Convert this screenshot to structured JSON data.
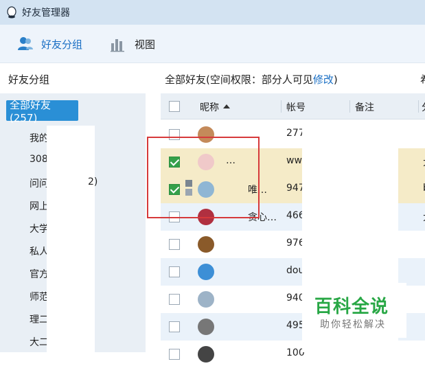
{
  "window": {
    "title": "好友管理器"
  },
  "toolbar": {
    "groups_label": "好友分组",
    "view_label": "视图"
  },
  "left": {
    "header": "好友分组",
    "all_group": "全部好友(257)",
    "groups": [
      "我的",
      "308",
      "问问",
      "网上",
      "大学",
      "私人",
      "官方",
      "师范",
      "理二",
      "大二"
    ],
    "partial_count": "2)"
  },
  "right": {
    "header_prefix": "全部好友(空间权限：部分人可见",
    "header_link": "修改",
    "header_suffix": ")",
    "edge_char": "希"
  },
  "table": {
    "columns": {
      "nickname": "昵称",
      "account": "帐号",
      "remark": "备注",
      "edge": "分"
    },
    "rows": [
      {
        "checked": false,
        "nickname": "",
        "account": "277",
        "bg": "#ffffff",
        "avatar_color": "#c48a5a",
        "edge": ""
      },
      {
        "checked": true,
        "nickname": "…",
        "account": "ww",
        "bg": "#f5ebc8",
        "avatar_color": "#f0c9c9",
        "edge": "大"
      },
      {
        "checked": true,
        "nickname": "唯…",
        "account": "947",
        "bg": "#f5ebc8",
        "avatar_color": "#8fb6d4",
        "edge": "b"
      },
      {
        "checked": false,
        "nickname": "贪心…",
        "account": "466",
        "bg": "#eaf2fa",
        "avatar_color": "#b03040",
        "edge": "大"
      },
      {
        "checked": false,
        "nickname": "",
        "account": "976",
        "bg": "#ffffff",
        "avatar_color": "#8a5a2a",
        "edge": ""
      },
      {
        "checked": false,
        "nickname": "",
        "account": "dou",
        "bg": "#eaf2fa",
        "avatar_color": "#3d8fd6",
        "edge": ""
      },
      {
        "checked": false,
        "nickname": "",
        "account": "940",
        "bg": "#ffffff",
        "avatar_color": "#9db3c7",
        "edge": ""
      },
      {
        "checked": false,
        "nickname": "",
        "account": "495",
        "bg": "#eaf2fa",
        "avatar_color": "#777777",
        "edge": ""
      },
      {
        "checked": false,
        "nickname": "",
        "account": "100",
        "bg": "#ffffff",
        "avatar_color": "#444444",
        "edge": ""
      }
    ]
  },
  "watermark": {
    "title": "百科全说",
    "subtitle": "助你轻松解决"
  },
  "colors": {
    "accent": "#2a8fd6",
    "highlight": "#d6393a",
    "check": "#35a04a",
    "selected_row": "#f5ebc8"
  }
}
